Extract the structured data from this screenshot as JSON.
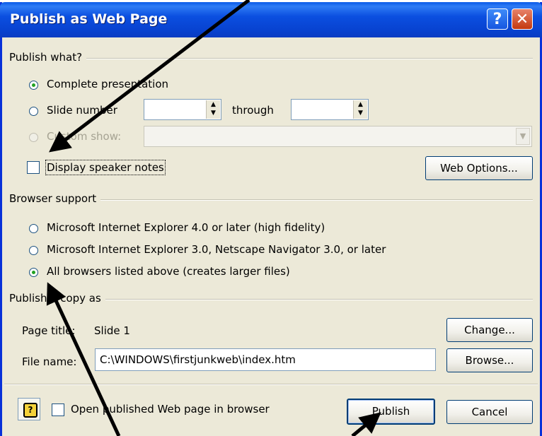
{
  "window": {
    "title": "Publish as Web Page",
    "help_glyph": "?",
    "close_glyph": "✕"
  },
  "publish_what": {
    "group_label": "Publish what?",
    "complete_presentation": "Complete presentation",
    "slide_number": "Slide number",
    "through": "through",
    "custom_show": "Custom show:",
    "display_speaker_notes": "Display speaker notes",
    "web_options": "Web Options..."
  },
  "browser_support": {
    "group_label": "Browser support",
    "option_ie4": "Microsoft Internet Explorer 4.0 or later (high fidelity)",
    "option_ie3": "Microsoft Internet Explorer 3.0, Netscape Navigator 3.0, or later",
    "option_all": "All browsers listed above (creates larger files)"
  },
  "publish_copy": {
    "group_label": "Publish a copy as",
    "page_title_label": "Page title:",
    "page_title_value": "Slide 1",
    "change_button": "Change...",
    "file_name_label": "File name:",
    "file_name_value": "C:\\WINDOWS\\firstjunkweb\\index.htm",
    "browse_button": "Browse..."
  },
  "footer": {
    "open_in_browser": "Open published Web page in browser",
    "publish_button": "Publish",
    "cancel_button": "Cancel"
  },
  "colors": {
    "titlebar": "#0842d0",
    "dialog_bg": "#ece9d8",
    "radio_dot": "#21a121"
  },
  "icons": {
    "help": "question-mark-icon",
    "close": "close-icon",
    "spin": "spin-arrows-icon",
    "dropdown": "chevron-down-icon"
  }
}
